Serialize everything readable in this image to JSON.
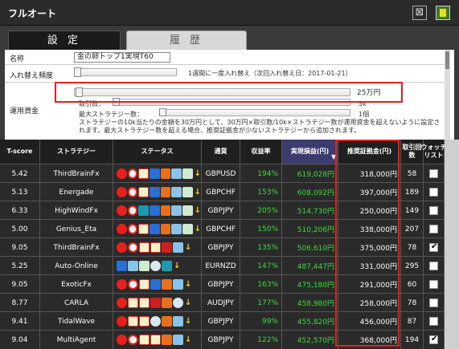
{
  "window": {
    "title": "フルオート",
    "close_glyph": "⊠"
  },
  "tabs": [
    {
      "label": "設 定"
    },
    {
      "label": "履 歴"
    }
  ],
  "form": {
    "name_label": "名称",
    "name_value": "金の卵トップ1実現T60",
    "rebalance_label": "入れ替え頻度",
    "rebalance_text": "1週間に一度入れ替え（次回入れ替え日：2017-01-21）",
    "capital_label": "運用資金",
    "capital_value": "25万円",
    "lot_label": "取引数：",
    "lot_value": "5k",
    "max_label": "最大ストラテジー数：",
    "max_value": "1個",
    "note": "ストラテジーの10k当たりの金額を30万円として、30万円×取引数/10k×ストラテジー数が運用資金を超えないように設定されます。最大ストラテジー数を超える場合、推奨証拠金が少ないストラテジーから追加されます。",
    "note2": "ジー数を超える場合、推奨証拠金が少ないストラテジーから追加されます。"
  },
  "table": {
    "headers": [
      "T-score",
      "ストラテジー",
      "ステータス",
      "通貨",
      "収益率",
      "実現損益(円)",
      "推奨証拠金(円)",
      "取引回数",
      "ウォッチ\nリスト"
    ],
    "rows": [
      {
        "tscore": "5.42",
        "strategy": "ThirdBrainFx",
        "currency": "GBPUSD",
        "return": "194%",
        "pnl": "619,028円",
        "margin": "318,000円",
        "trades": "58",
        "watch": false
      },
      {
        "tscore": "5.13",
        "strategy": "Energade",
        "currency": "GBPCHF",
        "return": "153%",
        "pnl": "608,092円",
        "margin": "397,000円",
        "trades": "189",
        "watch": false
      },
      {
        "tscore": "6.33",
        "strategy": "HighWindFx",
        "currency": "GBPJPY",
        "return": "205%",
        "pnl": "514,730円",
        "margin": "250,000円",
        "trades": "149",
        "watch": false
      },
      {
        "tscore": "5.00",
        "strategy": "Genius_Eta",
        "currency": "GBPCHF",
        "return": "150%",
        "pnl": "510,206円",
        "margin": "338,000円",
        "trades": "207",
        "watch": false
      },
      {
        "tscore": "9.05",
        "strategy": "ThirdBrainFx",
        "currency": "GBPJPY",
        "return": "135%",
        "pnl": "506,610円",
        "margin": "375,000円",
        "trades": "78",
        "watch": true
      },
      {
        "tscore": "5.25",
        "strategy": "Auto-Online",
        "currency": "EURNZD",
        "return": "147%",
        "pnl": "487,447円",
        "margin": "331,000円",
        "trades": "295",
        "watch": false
      },
      {
        "tscore": "9.05",
        "strategy": "ExoticFx",
        "currency": "GBPJPY",
        "return": "163%",
        "pnl": "475,180円",
        "margin": "291,000円",
        "trades": "60",
        "watch": false
      },
      {
        "tscore": "8.77",
        "strategy": "CARLA",
        "currency": "AUDJPY",
        "return": "177%",
        "pnl": "458,980円",
        "margin": "258,000円",
        "trades": "78",
        "watch": false
      },
      {
        "tscore": "9.41",
        "strategy": "TidalWave",
        "currency": "GBPJPY",
        "return": "99%",
        "pnl": "455,820円",
        "margin": "456,000円",
        "trades": "87",
        "watch": false
      },
      {
        "tscore": "9.04",
        "strategy": "MultiAgent",
        "currency": "GBPJPY",
        "return": "122%",
        "pnl": "452,570円",
        "margin": "368,000円",
        "trades": "194",
        "watch": true
      }
    ]
  },
  "colors": {
    "accent_red": "#e02020",
    "positive_green": "#3ddb3d",
    "header_dark": "#1f1f1f"
  }
}
